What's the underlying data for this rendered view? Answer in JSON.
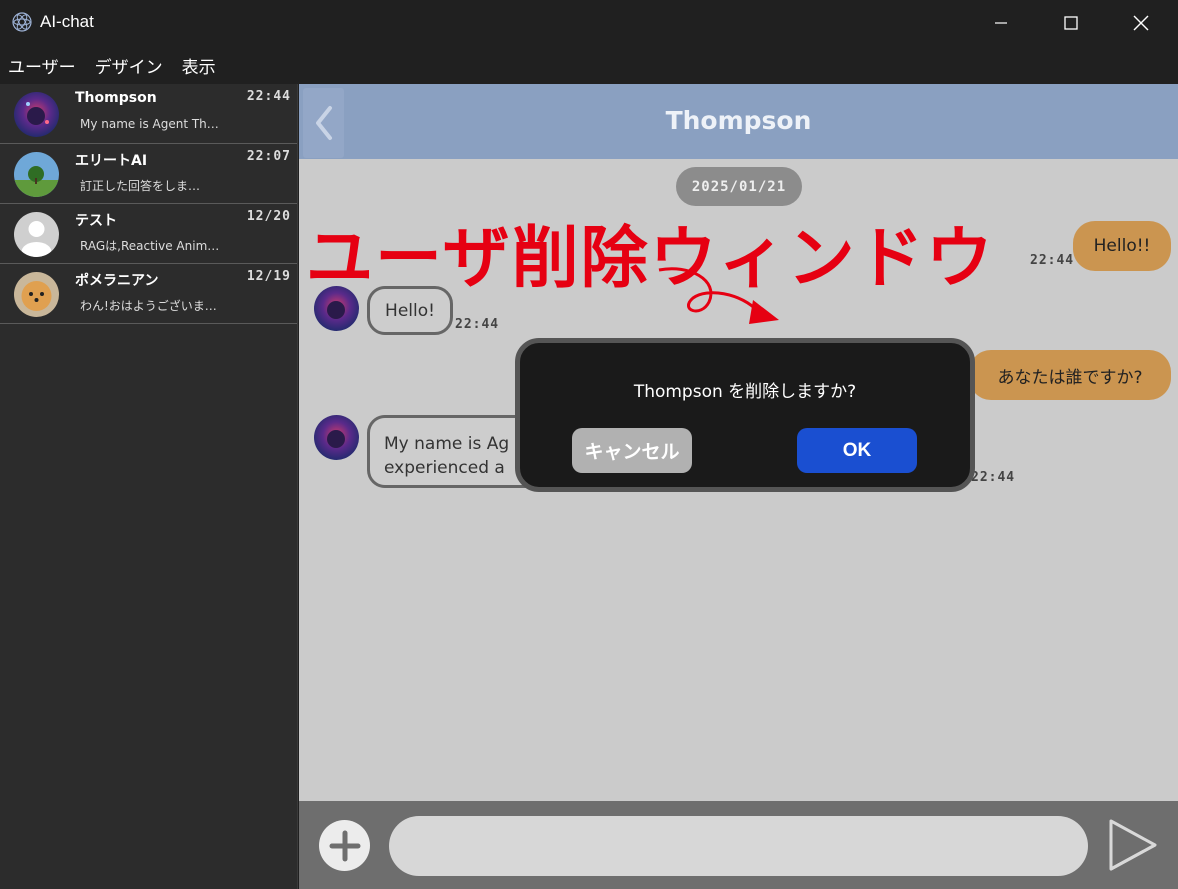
{
  "window": {
    "title": "AI-chat"
  },
  "menu": [
    "ユーザー",
    "デザイン",
    "表示"
  ],
  "contacts": [
    {
      "name": "Thompson",
      "time": "22:44",
      "preview": "My name is Agent Th…"
    },
    {
      "name": "エリートAI",
      "time": "22:07",
      "preview": "訂正した回答をしま…"
    },
    {
      "name": "テスト",
      "time": "12/20",
      "preview": "RAGは,Reactive Anim…"
    },
    {
      "name": "ポメラニアン",
      "time": "12/19",
      "preview": "わん!おはようございま…"
    }
  ],
  "chat": {
    "title": "Thompson",
    "date": "2025/01/21",
    "messages": [
      {
        "from": "me",
        "text": "Hello!!",
        "time": "22:44"
      },
      {
        "from": "bot",
        "text": "Hello!",
        "time": "22:44"
      },
      {
        "from": "me",
        "text": "あなたは誰ですか?",
        "time": ""
      },
      {
        "from": "bot",
        "text_line1": "My name is Ag",
        "text_line2": "experienced a",
        "time": "22:44"
      }
    ]
  },
  "annotation": {
    "text": "ユーザ削除ウィンドウ",
    "color": "#e60012"
  },
  "dialog": {
    "message": "Thompson を削除しますか?",
    "cancel_label": "キャンセル",
    "ok_label": "OK"
  },
  "input": {
    "placeholder": ""
  },
  "colors": {
    "header": "#8aa0c1",
    "outgoing_bubble": "#cb9550",
    "ok_button": "#1a4fd1",
    "chat_background": "#cbcbcb"
  }
}
